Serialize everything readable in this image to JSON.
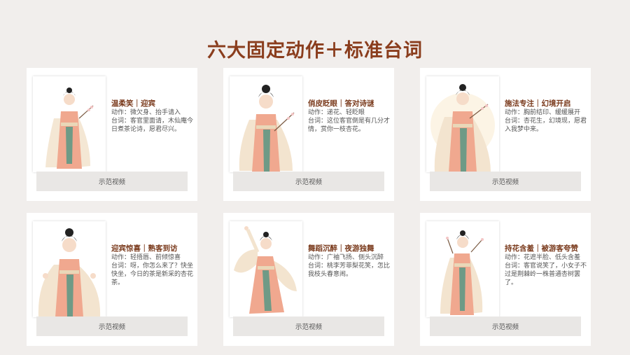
{
  "page": {
    "title": "六大固定动作＋标准台词",
    "accent_color": "#8a3d1d",
    "background_color": "#f1eeec"
  },
  "cards": [
    {
      "title": "温柔笑｜迎宾",
      "action": "动作：微欠身、抬手请入",
      "line": "台词：客官里面请，木仙庵今日煮茶论诗，愿君尽兴。",
      "button": "示范视频",
      "photo_icon": "hanfu-woman-holding-branch-icon"
    },
    {
      "title": "俏皮眨眼｜答对诗谜",
      "action": "动作：递花、轻眨眼",
      "line": "台词：这位客官倒是有几分才情，赏你一枝杏花。",
      "button": "示范视频",
      "photo_icon": "hanfu-woman-offering-flower-icon"
    },
    {
      "title": "施法专注｜幻境开启",
      "action": "动作：胸前结印、缓缓展开",
      "line": "台词：杏花生，幻境现，愿君入我梦中来。",
      "button": "示范视频",
      "photo_icon": "hanfu-woman-casting-spell-icon"
    },
    {
      "title": "迎宾惊喜｜熟客到访",
      "action": "动作：轻捂唇、前倾惊喜",
      "line": "台词：呀，你怎么来了？快坐快坐，今日的茶是新采的杏花茶。",
      "button": "示范视频",
      "photo_icon": "hanfu-woman-surprised-icon"
    },
    {
      "title": "舞蹈沉醉｜夜游独舞",
      "action": "动作：广袖飞扬、侧头沉醉",
      "line": "台词：桃李芳菲梨花笑，怎比我枝头春意闹。",
      "button": "示范视频",
      "photo_icon": "hanfu-woman-dancing-icon"
    },
    {
      "title": "持花含羞｜被游客夸赞",
      "action": "动作：花遮半脸、低头含羞",
      "line": "台词：客官说笑了，小女子不过是荆棘岭一株普通杏树罢了。",
      "button": "示范视频",
      "photo_icon": "hanfu-woman-shy-with-flower-icon"
    }
  ]
}
